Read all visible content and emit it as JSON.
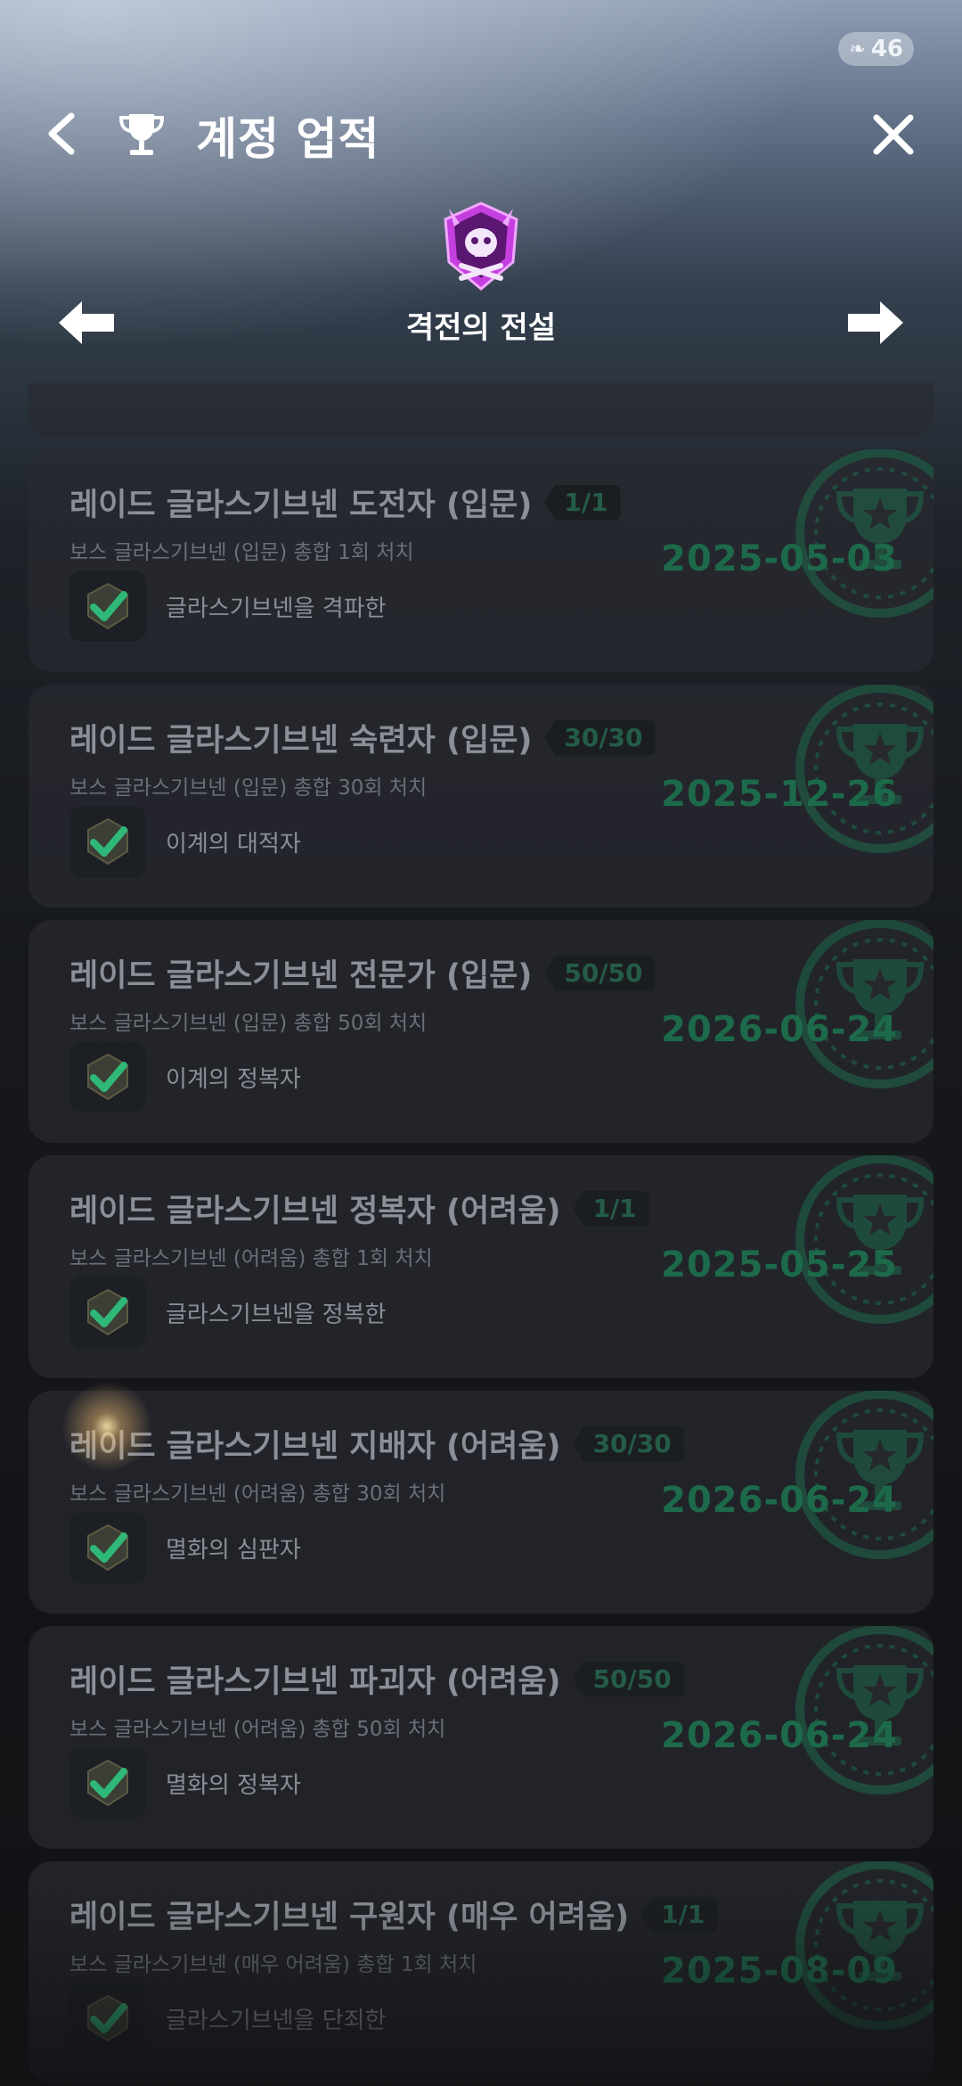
{
  "status": {
    "count": "46",
    "icon": "leaf-icon"
  },
  "header": {
    "title": "계정 업적",
    "icon": "trophy-icon"
  },
  "category": {
    "title": "격전의 전설",
    "icon": "demon-skull-emblem"
  },
  "achievements": [
    {
      "title": "레이드 글라스기브넨 도전자 (입문)",
      "progress": "1/1",
      "desc": "보스 글라스기브넨 (입문) 총합 1회 처치",
      "reward": "글라스기브넨을 격파한",
      "date": "2025-05-03"
    },
    {
      "title": "레이드 글라스기브넨 숙련자 (입문)",
      "progress": "30/30",
      "desc": "보스 글라스기브넨 (입문) 총합 30회 처치",
      "reward": "이계의 대적자",
      "date": "2025-12-26"
    },
    {
      "title": "레이드 글라스기브넨 전문가 (입문)",
      "progress": "50/50",
      "desc": "보스 글라스기브넨 (입문) 총합 50회 처치",
      "reward": "이계의 정복자",
      "date": "2026-06-24"
    },
    {
      "title": "레이드 글라스기브넨 정복자 (어려움)",
      "progress": "1/1",
      "desc": "보스 글라스기브넨 (어려움) 총합 1회 처치",
      "reward": "글라스기브넨을 정복한",
      "date": "2025-05-25"
    },
    {
      "title": "레이드 글라스기브넨 지배자 (어려움)",
      "progress": "30/30",
      "desc": "보스 글라스기브넨 (어려움) 총합 30회 처치",
      "reward": "멸화의 심판자",
      "date": "2026-06-24"
    },
    {
      "title": "레이드 글라스기브넨 파괴자 (어려움)",
      "progress": "50/50",
      "desc": "보스 글라스기브넨 (어려움) 총합 50회 처치",
      "reward": "멸화의 정복자",
      "date": "2026-06-24"
    },
    {
      "title": "레이드 글라스기브넨 구원자 (매우 어려움)",
      "progress": "1/1",
      "desc": "보스 글라스기브넨 (매우 어려움) 총합 1회 처치",
      "reward": "글라스기브넨을 단죄한",
      "date": "2025-08-09"
    }
  ],
  "colors": {
    "stamp": "#1d6a4b",
    "check": "#2fb877",
    "emblem": "#b02ad0"
  }
}
